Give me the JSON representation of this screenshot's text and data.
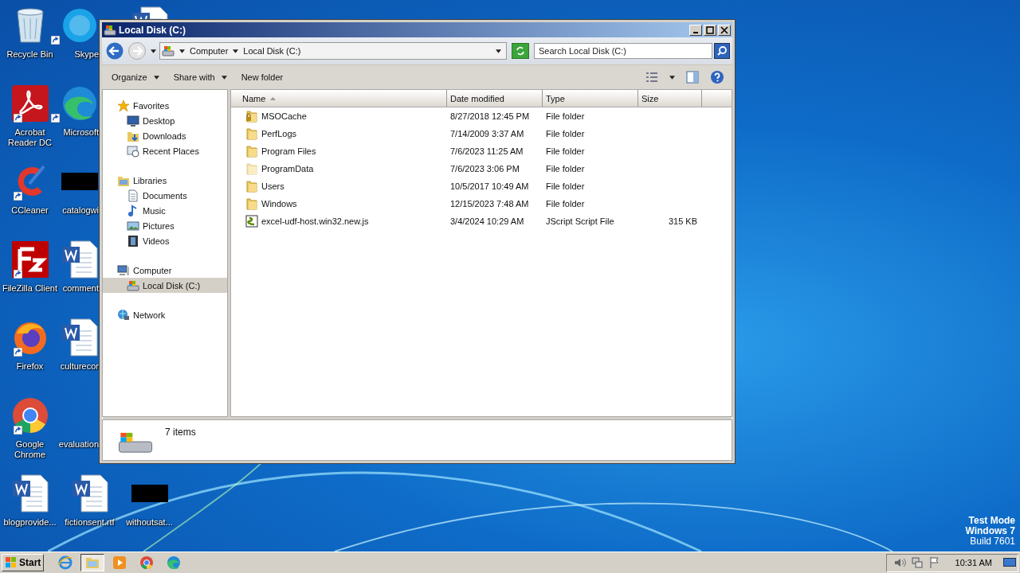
{
  "desktop": {
    "columns": [
      [
        {
          "kind": "recycle",
          "label": "Recycle Bin",
          "shortcut": false
        },
        {
          "kind": "acrobat",
          "label": "Acrobat Reader DC",
          "shortcut": true
        },
        {
          "kind": "ccleaner",
          "label": "CCleaner",
          "shortcut": true
        },
        {
          "kind": "filezilla",
          "label": "FileZilla Client",
          "shortcut": true
        },
        {
          "kind": "firefox",
          "label": "Firefox",
          "shortcut": true
        },
        {
          "kind": "chrome",
          "label": "Google Chrome",
          "shortcut": true
        },
        {
          "kind": "word",
          "label": "blogprovide...",
          "shortcut": false
        }
      ],
      [
        {
          "kind": "skype",
          "label": "Skype",
          "shortcut": true
        },
        {
          "kind": "edge",
          "label": "Microsoft",
          "shortcut": true
        },
        {
          "kind": "redacted",
          "label": "catalogwi",
          "shortcut": false
        },
        {
          "kind": "word",
          "label": "comment",
          "shortcut": false
        },
        {
          "kind": "word",
          "label": "culturecor",
          "shortcut": false
        },
        {
          "kind": "blank",
          "label": "evaluation",
          "shortcut": false
        },
        {
          "kind": "word",
          "label": "fictionsent.rtf",
          "shortcut": false
        }
      ],
      [
        {
          "kind": "word"
        },
        null,
        null,
        null,
        null,
        null,
        {
          "kind": "redacted",
          "label": "withoutsat...",
          "shortcut": false
        }
      ]
    ],
    "system_notice": [
      "Test Mode",
      "Windows 7",
      "Build 7601"
    ]
  },
  "explorer": {
    "title": "Local Disk (C:)",
    "breadcrumb": [
      "Computer",
      "Local Disk (C:)"
    ],
    "search": {
      "placeholder": "Search Local Disk (C:)"
    },
    "toolbar": [
      {
        "label": "Organize",
        "dropdown": true
      },
      {
        "label": "Share with",
        "dropdown": true
      },
      {
        "label": "New folder",
        "dropdown": false
      }
    ],
    "nav": [
      {
        "kind": "star",
        "label": "Favorites",
        "selected": false,
        "children": [
          {
            "kind": "desktop",
            "label": "Desktop",
            "selected": false
          },
          {
            "kind": "downloads",
            "label": "Downloads",
            "selected": false
          },
          {
            "kind": "recent",
            "label": "Recent Places",
            "selected": false
          }
        ]
      },
      {
        "kind": "libraries",
        "label": "Libraries",
        "selected": false,
        "children": [
          {
            "kind": "document",
            "label": "Documents",
            "selected": false
          },
          {
            "kind": "music",
            "label": "Music",
            "selected": false
          },
          {
            "kind": "pictures",
            "label": "Pictures",
            "selected": false
          },
          {
            "kind": "videos",
            "label": "Videos",
            "selected": false
          }
        ]
      },
      {
        "kind": "computer",
        "label": "Computer",
        "selected": false,
        "children": [
          {
            "kind": "drive",
            "label": "Local Disk (C:)",
            "selected": true
          }
        ]
      },
      {
        "kind": "network",
        "label": "Network",
        "selected": false
      }
    ],
    "table": {
      "columns": [
        {
          "label": "Name",
          "sorted": true
        },
        {
          "label": "Date modified",
          "sorted": false
        },
        {
          "label": "Type",
          "sorted": false
        },
        {
          "label": "Size",
          "sorted": false
        }
      ],
      "rows": [
        {
          "kind": "locked-folder",
          "name": "MSOCache",
          "date": "8/27/2018 12:45 PM",
          "type": "File folder",
          "hidden": false
        },
        {
          "kind": "folder",
          "name": "PerfLogs",
          "date": "7/14/2009 3:37 AM",
          "type": "File folder",
          "hidden": false
        },
        {
          "kind": "folder",
          "name": "Program Files",
          "date": "7/6/2023 11:25 AM",
          "type": "File folder",
          "hidden": false
        },
        {
          "kind": "folder",
          "name": "ProgramData",
          "date": "7/6/2023 3:06 PM",
          "type": "File folder",
          "hidden": true
        },
        {
          "kind": "folder",
          "name": "Users",
          "date": "10/5/2017 10:49 AM",
          "type": "File folder",
          "hidden": false
        },
        {
          "kind": "folder",
          "name": "Windows",
          "date": "12/15/2023 7:48 AM",
          "type": "File folder",
          "hidden": false
        },
        {
          "kind": "script",
          "name": "excel-udf-host.win32.new.js",
          "date": "3/4/2024 10:29 AM",
          "type": "JScript Script File",
          "size": "315 KB",
          "hidden": false
        }
      ]
    },
    "status": "7 items"
  },
  "taskbar": {
    "start": "Start",
    "apps": [
      {
        "kind": "ie",
        "selected": false
      },
      {
        "kind": "explorer",
        "selected": true
      },
      {
        "kind": "media",
        "selected": false
      },
      {
        "kind": "chrome",
        "selected": false
      },
      {
        "kind": "edge",
        "selected": false
      }
    ],
    "clock": "10:31 AM"
  }
}
